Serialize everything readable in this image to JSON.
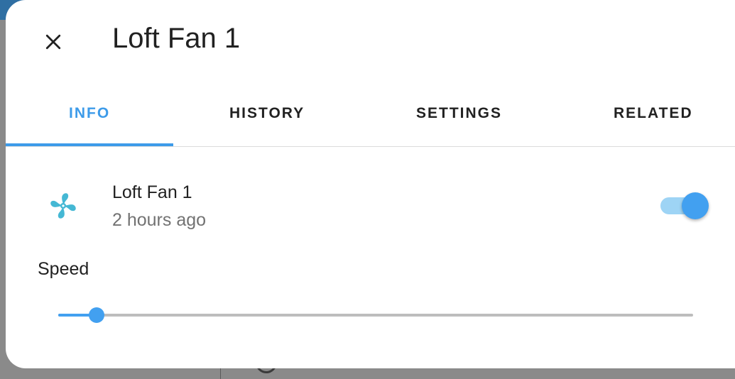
{
  "dialog": {
    "title": "Loft Fan 1"
  },
  "tabs": [
    {
      "label": "INFO",
      "active": true
    },
    {
      "label": "HISTORY",
      "active": false
    },
    {
      "label": "SETTINGS",
      "active": false
    },
    {
      "label": "RELATED",
      "active": false
    }
  ],
  "entity": {
    "name": "Loft Fan 1",
    "last_changed": "2 hours ago",
    "icon": "fan-icon",
    "state_on": true
  },
  "speed": {
    "label": "Speed",
    "value_fraction": 0.06
  },
  "colors": {
    "accent": "#3d9be9",
    "fan_icon": "#45b8d4",
    "toggle_track": "#9ed4f5"
  }
}
